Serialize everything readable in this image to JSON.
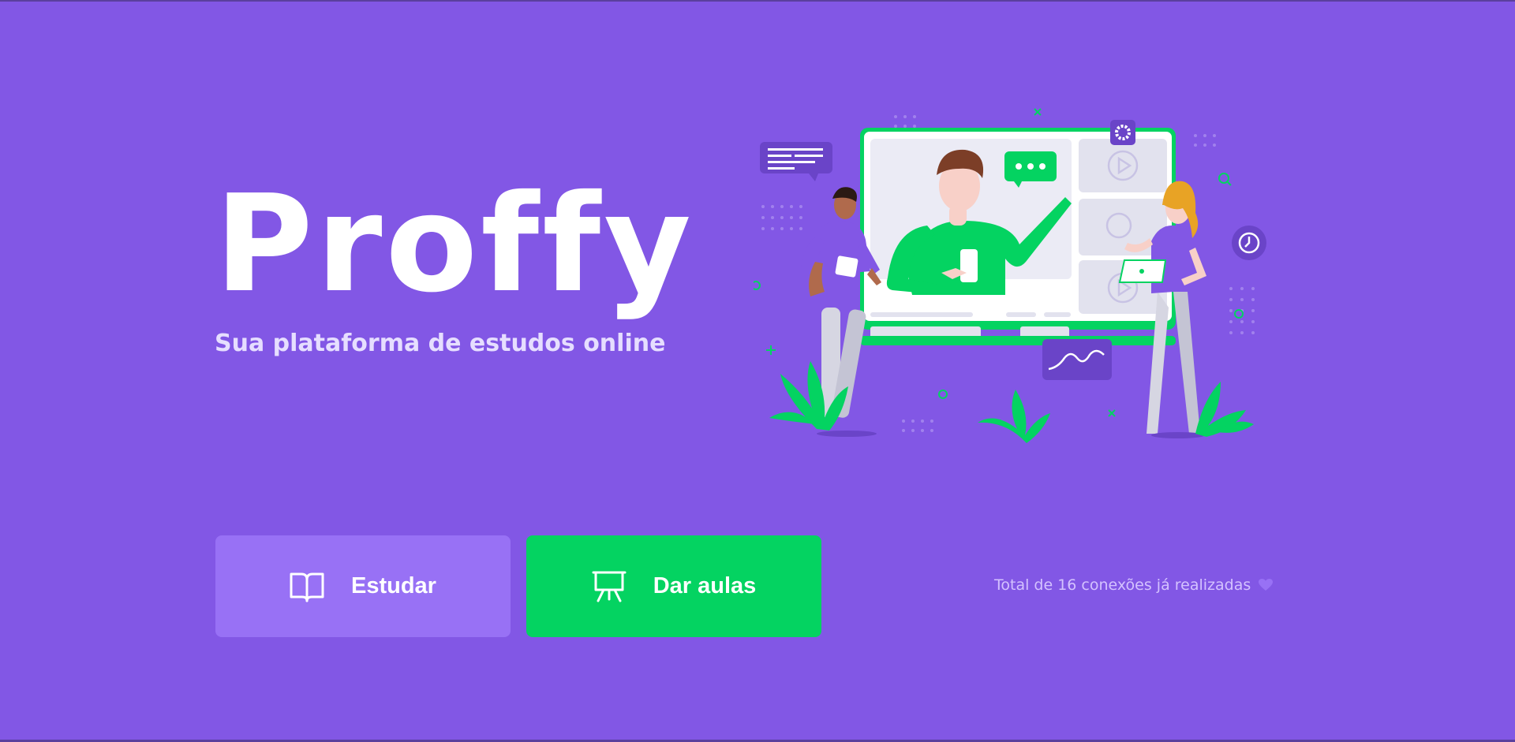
{
  "brand": {
    "logo_text": "Proffy",
    "tagline": "Sua plataforma de estudos online"
  },
  "illustration": {
    "name": "hero-illustration"
  },
  "buttons": {
    "study": {
      "label": "Estudar",
      "icon": "book-icon"
    },
    "teach": {
      "label": "Dar aulas",
      "icon": "presentation-board-icon"
    }
  },
  "footer": {
    "total_connections": "Total de 16 conexões já realizadas",
    "heart_icon": "heart-icon"
  },
  "colors": {
    "background": "#8257e5",
    "study_button": "#9871f5",
    "teach_button": "#04d361",
    "text_light": "#d4c2ff"
  }
}
